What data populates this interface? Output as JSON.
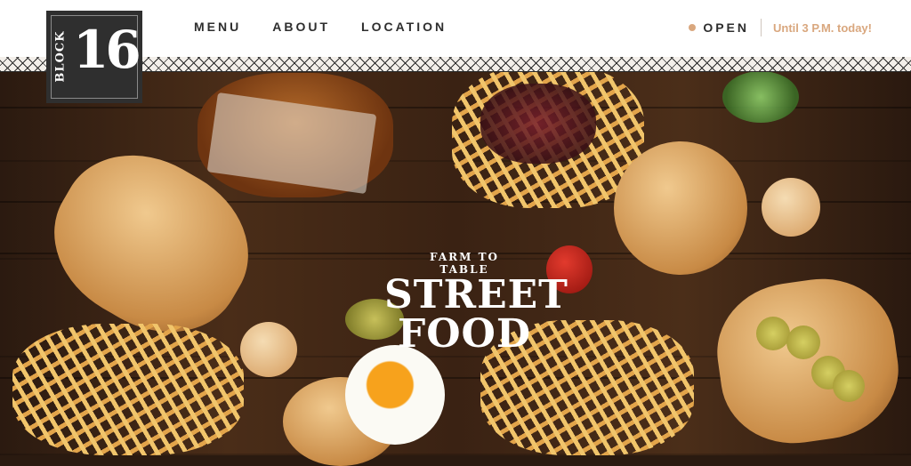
{
  "brand": {
    "word": "BLOCK",
    "number": "16"
  },
  "nav": [
    {
      "label": "MENU"
    },
    {
      "label": "ABOUT"
    },
    {
      "label": "LOCATION"
    }
  ],
  "status": {
    "label": "OPEN",
    "hours": "Until 3 P.M. today!"
  },
  "hero": {
    "tag_line1": "FARM TO",
    "tag_line2": "TABLE",
    "tag_big1": "STREET",
    "tag_big2": "FOOD"
  },
  "colors": {
    "accent": "#d9a77e",
    "nav_text": "#2e2e2e",
    "logo_bg": "#2f2f2f"
  }
}
